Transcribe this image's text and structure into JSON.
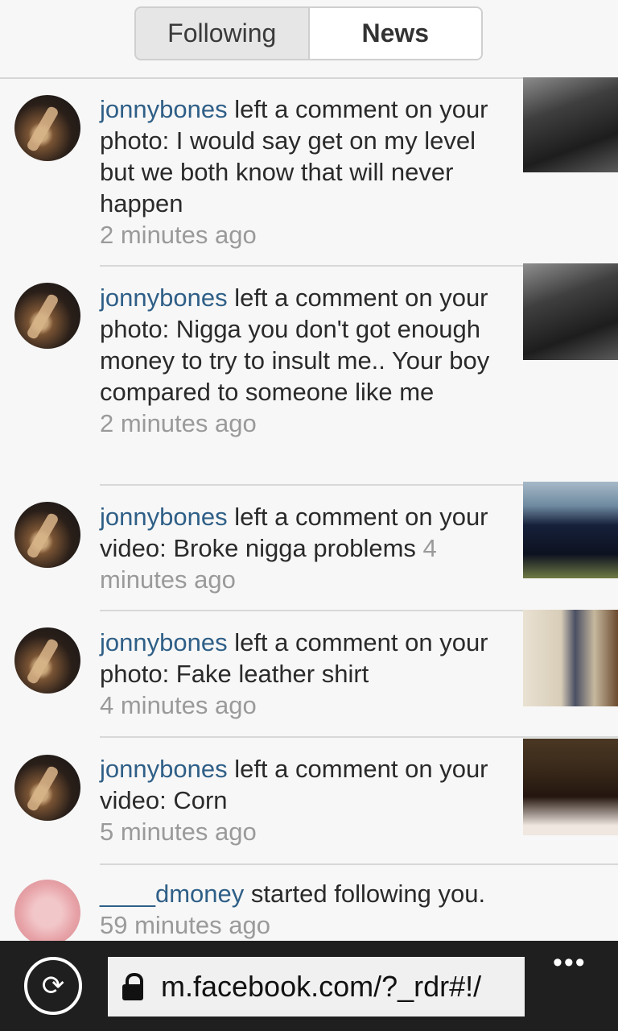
{
  "tabs": [
    {
      "label": "Following",
      "active": false
    },
    {
      "label": "News",
      "active": true
    }
  ],
  "feed": [
    {
      "user": "jonnybones",
      "action": " left a comment on your photo: I would say get on my level but we both know that will never happen",
      "time": "2 minutes ago"
    },
    {
      "user": "jonnybones",
      "action": " left a comment on your photo: Nigga you don't got enough money to try to insult me.. Your boy compared to someone like me",
      "time": "2 minutes ago"
    },
    {
      "user": "jonnybones",
      "action": " left a comment on your video: Broke nigga problems ",
      "time": "4 minutes ago"
    },
    {
      "user": "jonnybones",
      "action": " left a comment on your photo: Fake leather shirt",
      "time": "4 minutes ago"
    },
    {
      "user": "jonnybones",
      "action": " left a comment on your video: Corn",
      "time": "5 minutes ago"
    },
    {
      "user": "____dmoney",
      "action": " started following you.",
      "time": "59 minutes ago"
    }
  ],
  "browser": {
    "url": "m.facebook.com/?_rdr#!/",
    "more": "•••"
  },
  "icons": {
    "refresh": "refresh-icon",
    "lock": "lock-icon",
    "more": "more-icon"
  }
}
